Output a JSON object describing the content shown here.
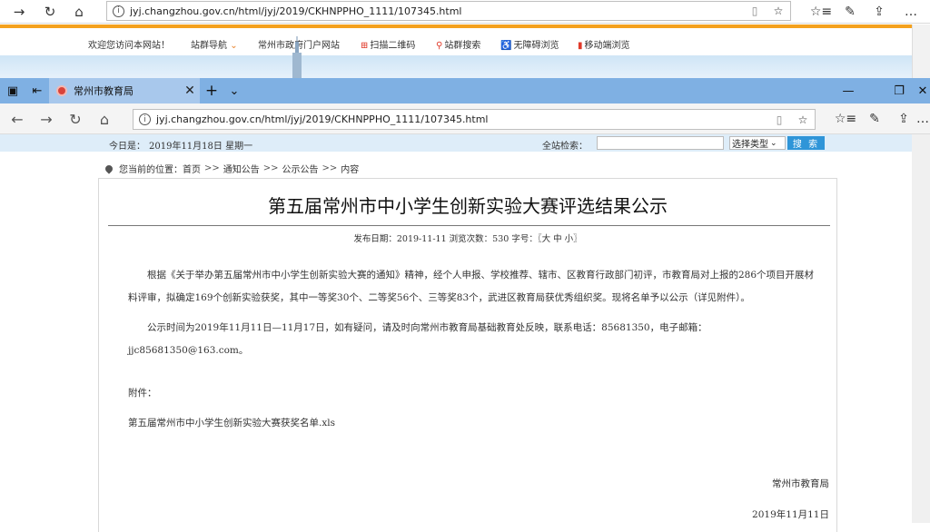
{
  "back_browser": {
    "url": "jyj.changzhou.gov.cn/html/jyj/2019/CKHNPPHO_1111/107345.html"
  },
  "back_site_nav": {
    "welcome": "欢迎您访问本网站！",
    "site_nav": "站群导航",
    "gov_portal": "常州市政府门户网站",
    "qr_code": "扫描二维码",
    "site_search": "站群搜索",
    "accessibility": "无障碍浏览",
    "mobile": "移动端浏览"
  },
  "tab": {
    "title": "常州市教育局"
  },
  "front_browser": {
    "url": "jyj.changzhou.gov.cn/html/jyj/2019/CKHNPPHO_1111/107345.html"
  },
  "date_bar": {
    "today_label": "今日是：",
    "today_value": "2019年11月18日 星期一",
    "search_label": "全站检索：",
    "select_label": "选择类型",
    "search_button": "搜 索"
  },
  "breadcrumb": {
    "label": "您当前的位置：",
    "items": [
      "首页",
      "通知公告",
      "公示公告",
      "内容"
    ],
    "sep": ">>"
  },
  "article": {
    "title": "第五届常州市中小学生创新实验大赛评选结果公示",
    "meta": "发布日期：2019-11-11 浏览次数：530  字号：〖大 中 小〗",
    "p1": "根据《关于举办第五届常州市中小学生创新实验大赛的通知》精神，经个人申报、学校推荐、辖市、区教育行政部门初评，市教育局对上报的286个项目开展材料评审，拟确定169个创新实验获奖，其中一等奖30个、二等奖56个、三等奖83个，武进区教育局获优秀组织奖。现将名单予以公示（详见附件）。",
    "p2": "公示时间为2019年11月11日—11月17日，如有疑问，请及时向常州市教育局基础教育处反映，联系电话：85681350，电子邮箱：jjc85681350@163.com。",
    "attachment_label": "附件：",
    "attachment_file": "第五届常州市中小学生创新实验大赛获奖名单.xls",
    "signature": "常州市教育局",
    "sign_date": "2019年11月11日"
  }
}
